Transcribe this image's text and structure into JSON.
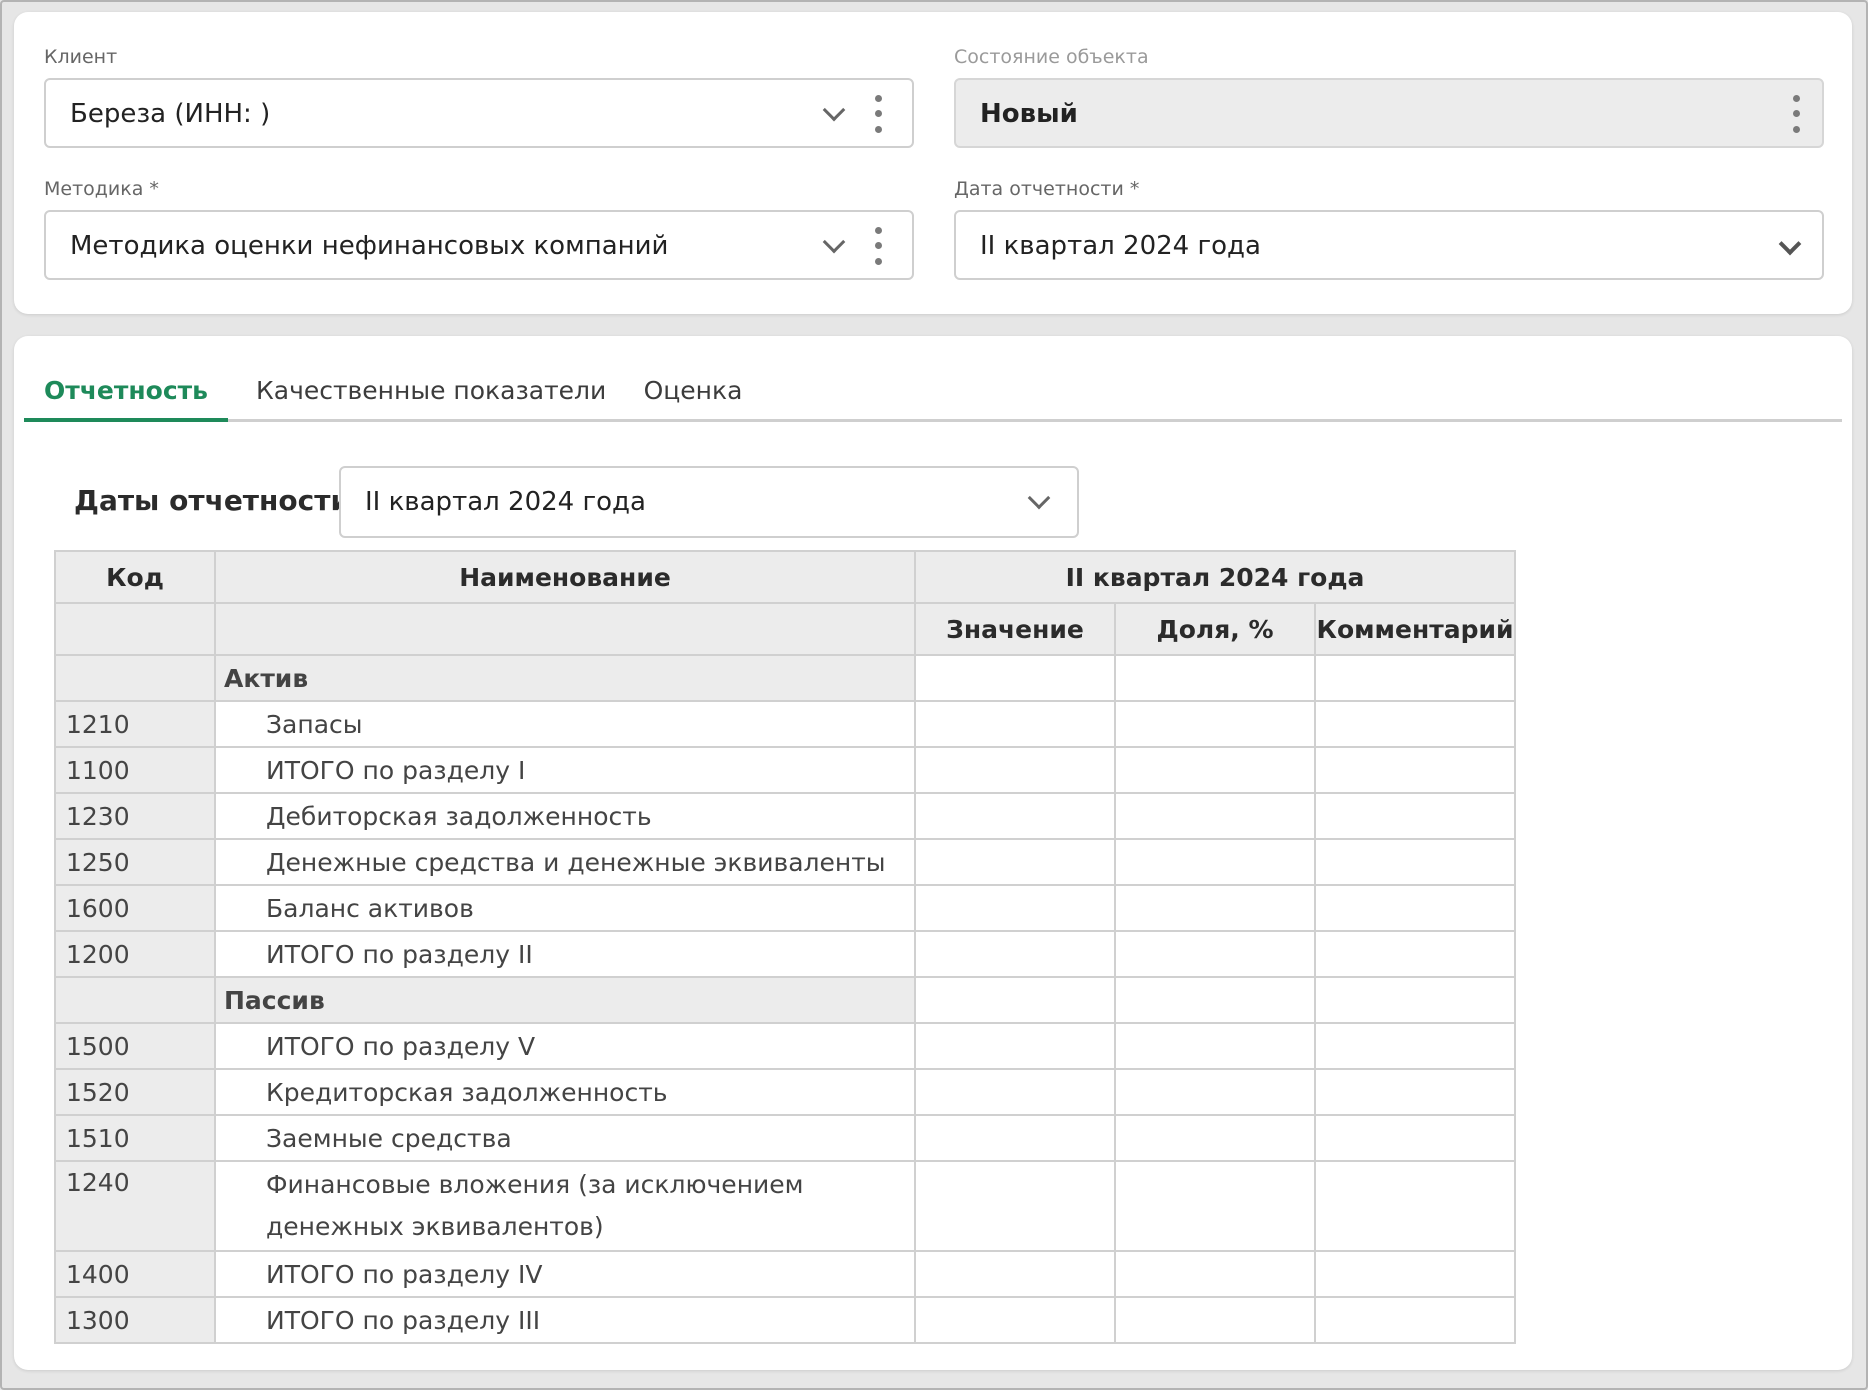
{
  "client": {
    "label": "Клиент",
    "value": "Береза (ИНН: )"
  },
  "object_state": {
    "label": "Состояние объекта",
    "value": "Новый"
  },
  "methodology": {
    "label": "Методика *",
    "value": "Методика оценки нефинансовых компаний"
  },
  "report_date": {
    "label": "Дата отчетности *",
    "value": "II квартал 2024 года"
  },
  "tabs": [
    {
      "label": "Отчетность",
      "active": true
    },
    {
      "label": "Качественные показатели",
      "active": false
    },
    {
      "label": "Оценка",
      "active": false
    }
  ],
  "dates_filter": {
    "label": "Даты отчетности",
    "value": "II квартал 2024 года"
  },
  "table": {
    "headers": {
      "code": "Код",
      "name": "Наименование",
      "period": "II квартал 2024 года",
      "value": "Значение",
      "share": "Доля, %",
      "comment": "Комментарий"
    },
    "sections": [
      {
        "title": "Актив",
        "rows": [
          {
            "code": "1210",
            "name": "Запасы"
          },
          {
            "code": "1100",
            "name": "ИТОГО по разделу I"
          },
          {
            "code": "1230",
            "name": "Дебиторская задолженность"
          },
          {
            "code": "1250",
            "name": "Денежные средства и денежные эквиваленты"
          },
          {
            "code": "1600",
            "name": "Баланс активов"
          },
          {
            "code": "1200",
            "name": "ИТОГО по разделу II"
          }
        ]
      },
      {
        "title": "Пассив",
        "rows": [
          {
            "code": "1500",
            "name": "ИТОГО по разделу V"
          },
          {
            "code": "1520",
            "name": "Кредиторская задолженность"
          },
          {
            "code": "1510",
            "name": "Заемные средства"
          },
          {
            "code": "1240",
            "name": "Финансовые вложения (за исключением денежных эквивалентов)"
          },
          {
            "code": "1400",
            "name": "ИТОГО по разделу IV"
          },
          {
            "code": "1300",
            "name": "ИТОГО по разделу III"
          }
        ]
      }
    ]
  },
  "colors": {
    "accent": "#1e8a5a",
    "header_bg": "#ececec",
    "border": "#d0d0d0"
  }
}
